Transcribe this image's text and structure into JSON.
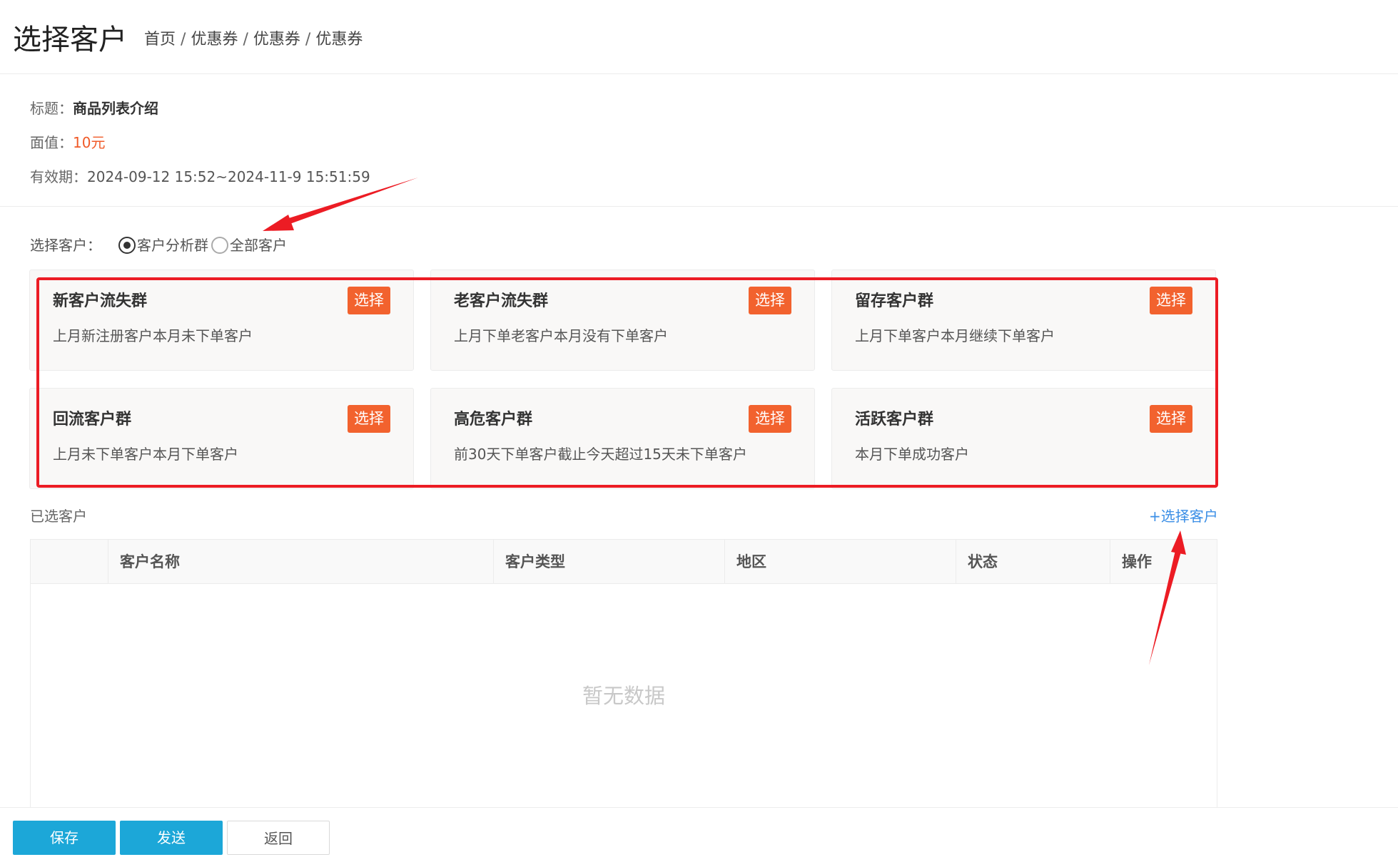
{
  "header": {
    "title": "选择客户",
    "breadcrumb": [
      "首页",
      "优惠券",
      "优惠券",
      "优惠券"
    ]
  },
  "coupon": {
    "title_label": "标题：",
    "title_value": "商品列表介绍",
    "face_label": "面值：",
    "face_value": "10元",
    "validity_label": "有效期：",
    "validity_value": "2024-09-12 15:52~2024-11-9 15:51:59"
  },
  "selector": {
    "label": "选择客户：",
    "options": [
      {
        "label": "客户分析群",
        "checked": true
      },
      {
        "label": "全部客户",
        "checked": false
      }
    ]
  },
  "groups": [
    {
      "title": "新客户流失群",
      "desc": "上月新注册客户本月未下单客户",
      "button": "选择"
    },
    {
      "title": "老客户流失群",
      "desc": "上月下单老客户本月没有下单客户",
      "button": "选择"
    },
    {
      "title": "留存客户群",
      "desc": "上月下单客户本月继续下单客户",
      "button": "选择"
    },
    {
      "title": "回流客户群",
      "desc": "上月未下单客户本月下单客户",
      "button": "选择"
    },
    {
      "title": "高危客户群",
      "desc": "前30天下单客户截止今天超过15天未下单客户",
      "button": "选择"
    },
    {
      "title": "活跃客户群",
      "desc": "本月下单成功客户",
      "button": "选择"
    }
  ],
  "selected": {
    "label": "已选客户",
    "add_link": "+选择客户",
    "columns": [
      "",
      "客户名称",
      "客户类型",
      "地区",
      "状态",
      "操作"
    ],
    "empty_text": "暂无数据"
  },
  "footer": {
    "save": "保存",
    "send": "发送",
    "back": "返回"
  },
  "colors": {
    "accent_orange": "#f2622e",
    "primary_blue": "#1ca7d8",
    "link_blue": "#3a8ee6",
    "annotation_red": "#ec1c24"
  }
}
